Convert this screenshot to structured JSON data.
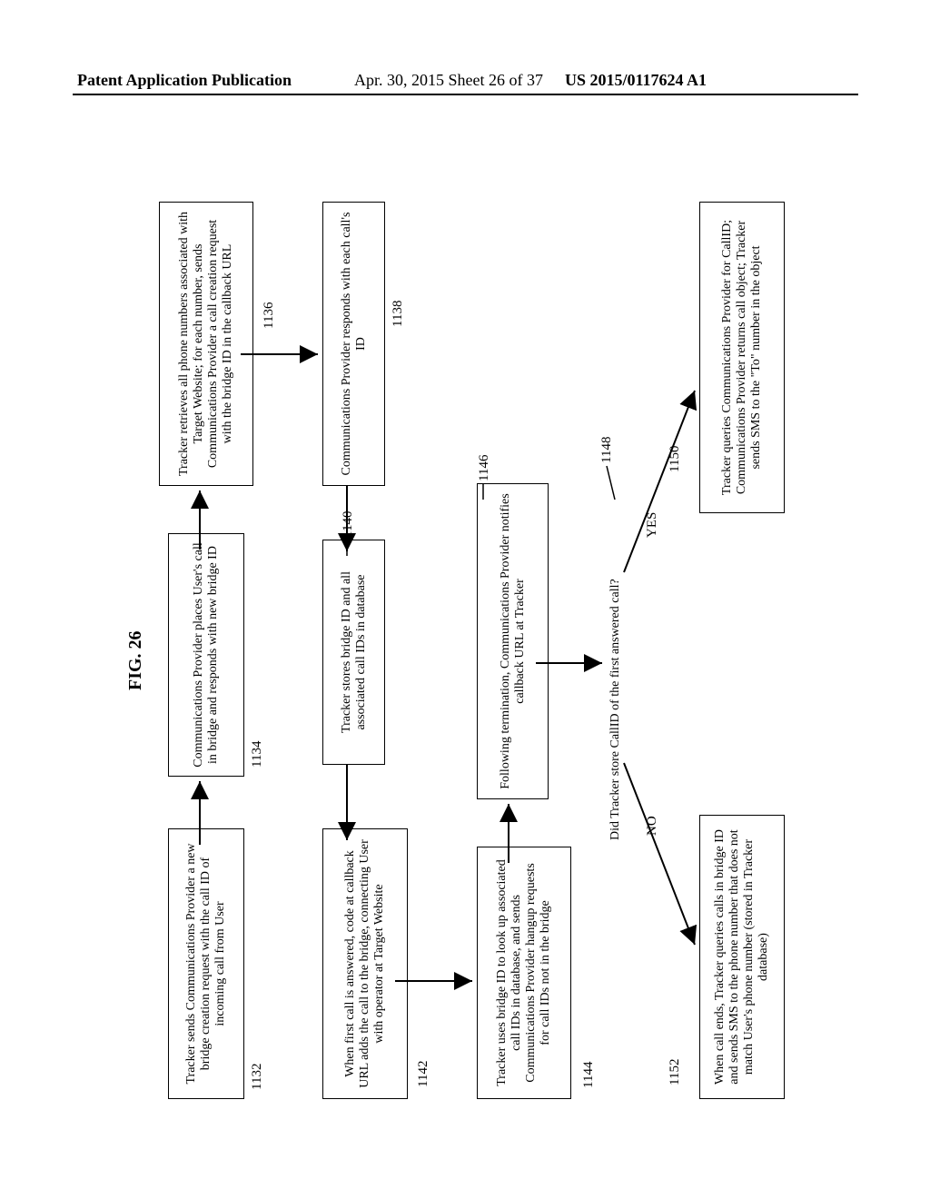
{
  "header": {
    "left": "Patent Application Publication",
    "mid": "Apr. 30, 2015  Sheet 26 of 37",
    "right": "US 2015/0117624 A1"
  },
  "figure": {
    "title": "FIG. 26"
  },
  "boxes": {
    "b1132": "Tracker sends Communications Provider a new bridge creation request with the call ID of incoming call from User",
    "b1134": "Communications Provider places User's call in bridge and responds with new bridge ID",
    "b1136": "Tracker retrieves all phone numbers associated with Target Website; for each number, sends Communications Provider a call creation request with the bridge ID in the callback URL",
    "b1138": "Communications Provider responds with each call's ID",
    "b1140": "Tracker stores bridge ID and all associated call IDs in database",
    "b1142": "When first call is answered, code at callback URL adds the call to the bridge, connecting User with operator at Target Website",
    "b1144": "Tracker uses bridge ID to look up associated call IDs in database, and sends Communications Provider hangup requests for call IDs not in the bridge",
    "b1146": "Following termination, Communications Provider notifies callback URL at Tracker",
    "b1148": "Did Tracker store CallID of the first answered call?",
    "b1150": "Tracker queries Communications Provider for CallID; Communications Provider returns call object; Tracker sends SMS to the \"To\" number in the object",
    "b1152": "When call ends, Tracker queries calls in bridge ID and sends SMS to the phone number that does not match User's phone number (stored in Tracker database)"
  },
  "decision": {
    "no": "NO",
    "yes": "YES"
  },
  "refs": {
    "r1132": "1132",
    "r1134": "1134",
    "r1136": "1136",
    "r1138": "1138",
    "r1140": "1140",
    "r1142": "1142",
    "r1144": "1144",
    "r1146": "1146",
    "r1148": "1148",
    "r1150": "1150",
    "r1152": "1152"
  }
}
